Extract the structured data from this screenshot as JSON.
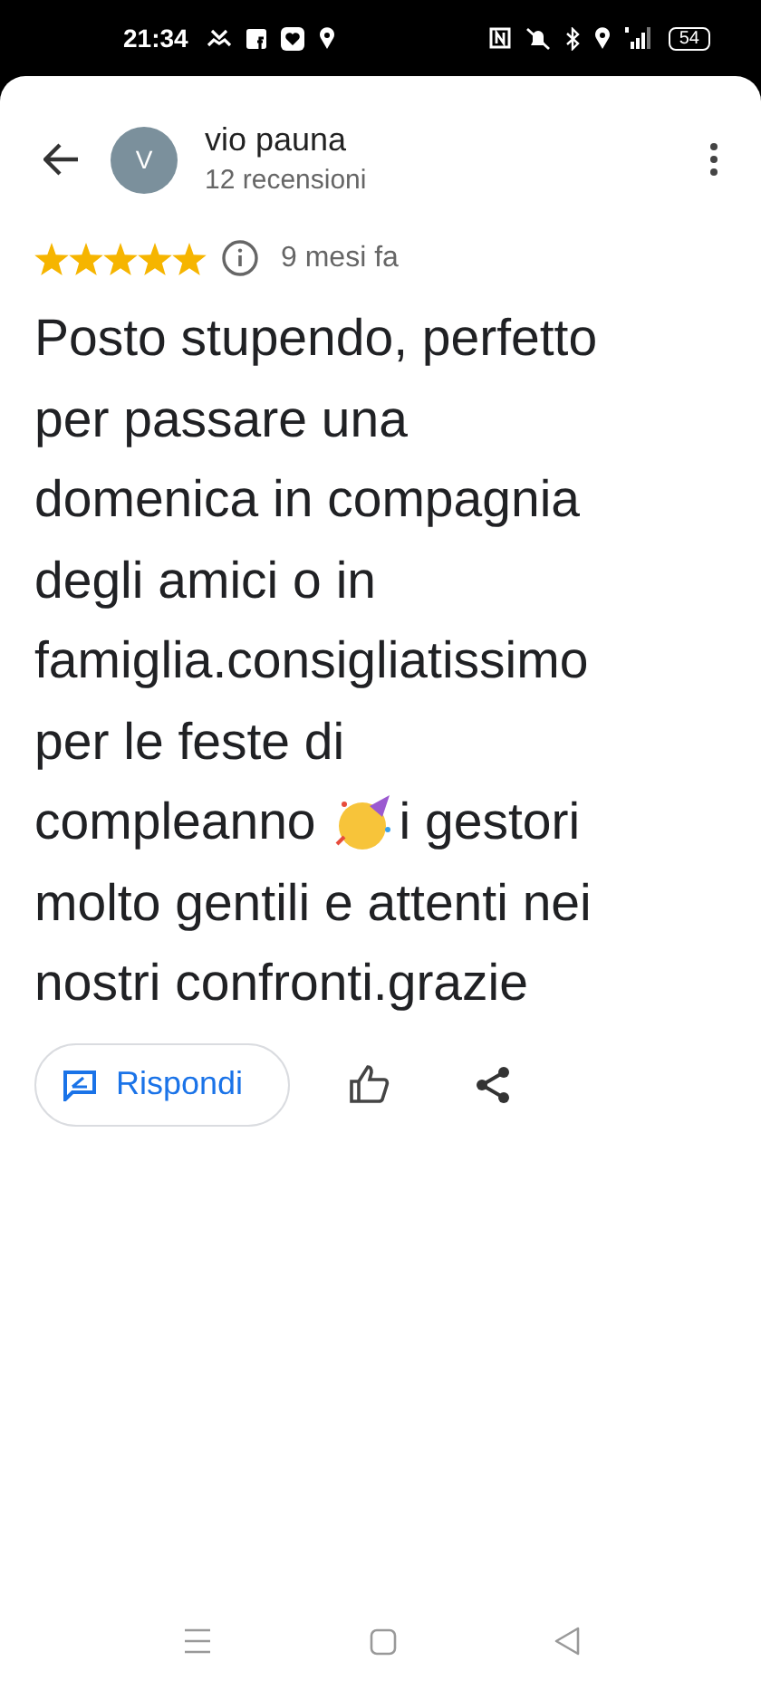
{
  "status_bar": {
    "time": "21:34",
    "battery": "54"
  },
  "reviewer": {
    "initial": "V",
    "name": "vio pauna",
    "reviews": "12 recensioni"
  },
  "review": {
    "stars": 5,
    "date": "9 mesi fa",
    "lines": [
      {
        "kind": "text",
        "text": "Posto stupendo, perfetto"
      },
      {
        "kind": "text",
        "text": "per passare una"
      },
      {
        "kind": "text",
        "text": "domenica in compagnia"
      },
      {
        "kind": "text",
        "text": "degli amici o in"
      },
      {
        "kind": "text",
        "text": "famiglia.consigliatissimo"
      },
      {
        "kind": "text",
        "text": "per le feste di"
      },
      {
        "kind": "emoji",
        "before": "compleanno",
        "after": "i gestori"
      },
      {
        "kind": "text",
        "text": "molto gentili e attenti nei"
      },
      {
        "kind": "text",
        "text": "nostri confronti.grazie"
      }
    ]
  },
  "actions": {
    "reply": "Rispondi"
  }
}
